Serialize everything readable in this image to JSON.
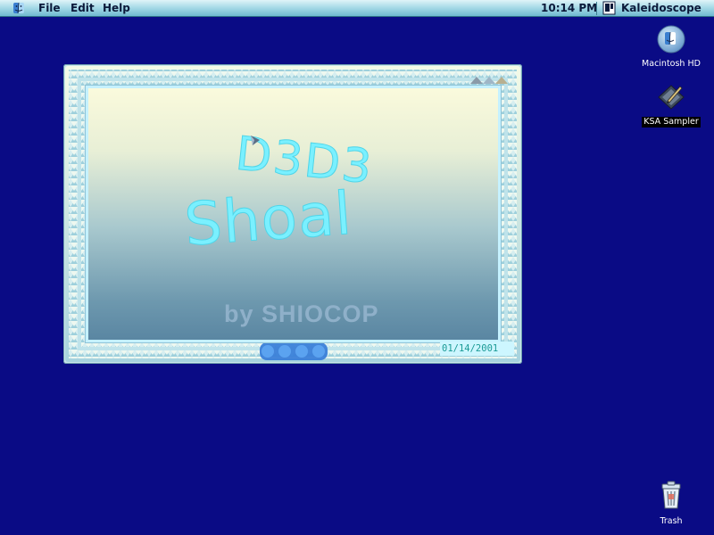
{
  "menubar": {
    "apple_menu": "apple-menu-icon",
    "items": [
      {
        "label": "File"
      },
      {
        "label": "Edit"
      },
      {
        "label": "Help"
      }
    ],
    "clock": "10:14 PM",
    "app_menu": {
      "name": "Kaleidoscope",
      "icon": "kaleidoscope-app-icon"
    }
  },
  "desktop": {
    "icons": [
      {
        "label": "Macintosh HD",
        "icon": "hard-drive-icon"
      },
      {
        "label": "KSA Sampler",
        "icon": "ksa-sampler-icon",
        "selected": true
      },
      {
        "label": "Trash",
        "icon": "trash-icon"
      }
    ]
  },
  "screensaver": {
    "title_line1": "D3D3",
    "title_line2": "Shoal",
    "credit": "by SHIOCOP",
    "date": "01/14/2001"
  },
  "colors": {
    "desktop": "#0a0b85",
    "logo_text": "#7af0ff",
    "credit_text": "#8fb0c9",
    "date_text": "#1b9a96"
  }
}
